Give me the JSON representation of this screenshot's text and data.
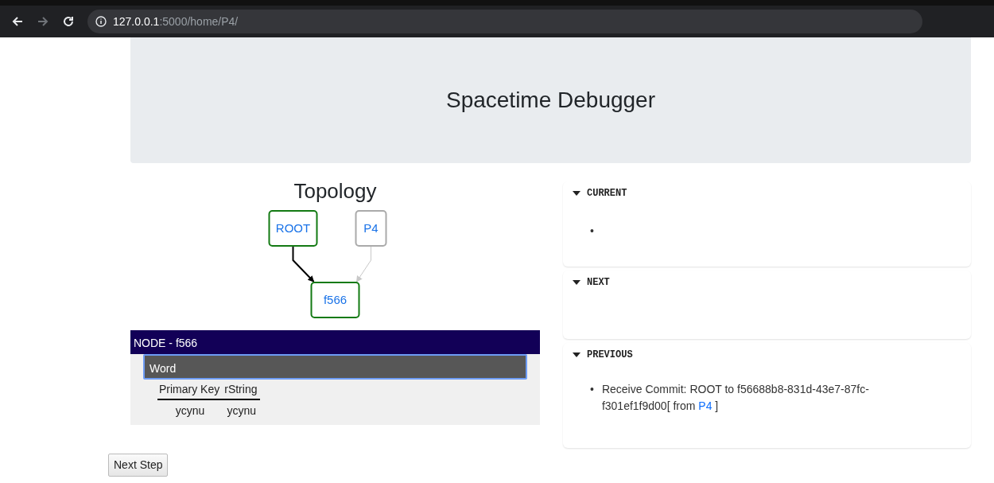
{
  "browser": {
    "back": {
      "disabled": false
    },
    "forward": {
      "disabled": true
    },
    "url_host": "127.0.0.1",
    "url_path": ":5000/home/P4/"
  },
  "header": {
    "title": "Spacetime Debugger"
  },
  "topology": {
    "title": "Topology",
    "nodes": [
      {
        "label": "ROOT",
        "color": "#137a13"
      },
      {
        "label": "P4",
        "color": "#aaaaaa"
      },
      {
        "label": "f566",
        "color": "#137a13"
      }
    ],
    "edges": [
      {
        "color": "#000000"
      },
      {
        "color": "#c8c8c8"
      }
    ]
  },
  "node_panel": {
    "title": "NODE - f566",
    "types": [
      {
        "label": "Word",
        "selected": true
      }
    ],
    "columns": [
      "Primary Key",
      "rString"
    ],
    "rows": [
      [
        "ycynu",
        "ycynu"
      ]
    ]
  },
  "sections": [
    {
      "title": "CURRENT",
      "expanded": true,
      "items": [
        {
          "kind": "empty",
          "bullet": "•"
        }
      ]
    },
    {
      "title": "NEXT",
      "expanded": true
    },
    {
      "title": "PREVIOUS",
      "expanded": true,
      "items": [
        {
          "kind": "commit",
          "bullet": "•",
          "text": "Receive Commit: ROOT to f56688b8-831d-43e7-87fc-f301ef1f9d00[ from",
          "link": "P4",
          "after": "]"
        }
      ]
    }
  ],
  "next_button": "Next Step"
}
